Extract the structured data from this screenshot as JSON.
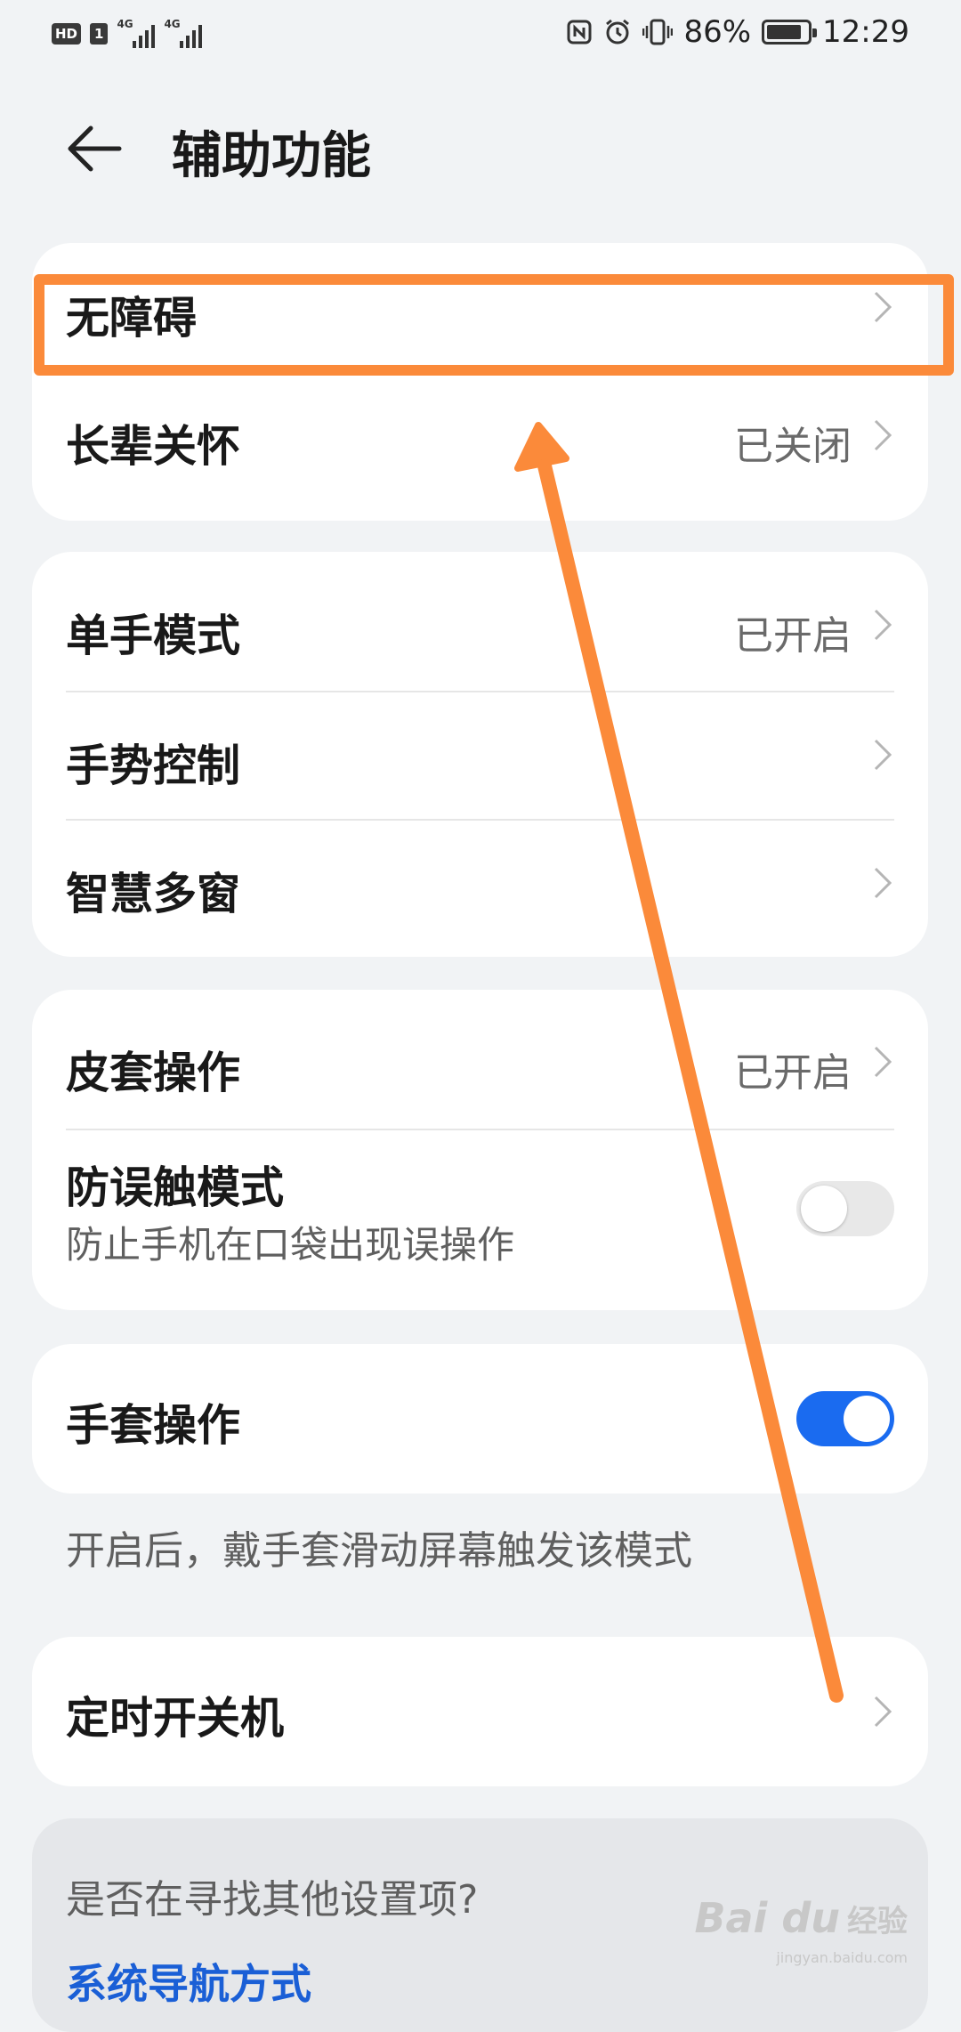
{
  "status_bar": {
    "hd": "HD",
    "sim": "1",
    "net1": "4G",
    "net2": "4G",
    "battery_percent": "86%",
    "battery_level": 0.86,
    "time": "12:29",
    "icons": [
      "nfc-icon",
      "alarm-icon",
      "vibrate-icon",
      "battery-icon"
    ]
  },
  "header": {
    "title": "辅助功能"
  },
  "card1": {
    "items": [
      {
        "label": "无障碍"
      },
      {
        "label": "长辈关怀",
        "value": "已关闭"
      }
    ]
  },
  "card2": {
    "items": [
      {
        "label": "单手模式",
        "value": "已开启"
      },
      {
        "label": "手势控制"
      },
      {
        "label": "智慧多窗"
      }
    ]
  },
  "card3": {
    "items": [
      {
        "label": "皮套操作",
        "value": "已开启"
      },
      {
        "label": "防误触模式",
        "sub": "防止手机在口袋出现误操作",
        "toggle": false
      }
    ]
  },
  "card4": {
    "items": [
      {
        "label": "手套操作",
        "toggle": true
      }
    ],
    "hint": "开启后，戴手套滑动屏幕触发该模式"
  },
  "card5": {
    "items": [
      {
        "label": "定时开关机"
      }
    ]
  },
  "find_more": {
    "question": "是否在寻找其他设置项?",
    "link": "系统导航方式"
  },
  "annotation": {
    "color": "#fb8a3a"
  },
  "colors": {
    "background": "#f1f3f5",
    "card": "#ffffff",
    "accent": "#1a6bf0",
    "link": "#1a5fd6"
  },
  "watermark": {
    "brand": "Bai du",
    "sub": "经验",
    "url": "jingyan.baidu.com"
  }
}
